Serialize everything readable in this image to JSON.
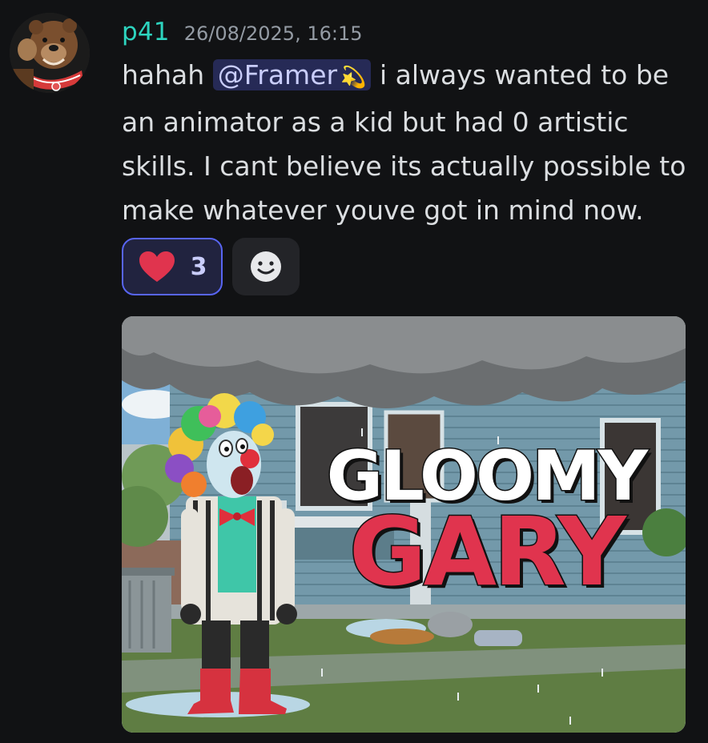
{
  "message": {
    "username": "p41",
    "username_color": "#2dd4bf",
    "timestamp": "26/08/2025, 16:15",
    "text_before_mention": "hahah ",
    "mention": "@Framer",
    "mention_emoji": "💫",
    "text_after_mention": "  i always wanted to be an animator as a kid but had 0 artistic skills. I cant believe its actually possible to make whatever youve got in mind now."
  },
  "reactions": [
    {
      "emoji": "heart-icon",
      "count": "3",
      "selected": true
    }
  ],
  "add_reaction_icon": "smiley-plus-icon",
  "attachment": {
    "title_line1": "GLOOMY",
    "title_line2": "GARY"
  },
  "colors": {
    "background": "#111214",
    "accent": "#5865f2",
    "heart": "#e0344e"
  }
}
